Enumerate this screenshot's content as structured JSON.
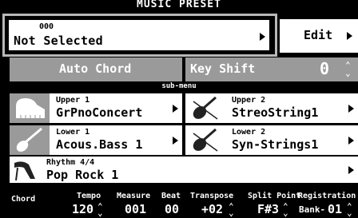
{
  "title": "MUSIC PRESET",
  "preset": {
    "number": "000",
    "name": "Not Selected"
  },
  "edit_label": "Edit",
  "auto_chord_label": "Auto Chord",
  "key_shift": {
    "label": "Key Shift",
    "value": "0"
  },
  "submenu_label": "sub-menu",
  "parts": {
    "upper1": {
      "label": "Upper 1",
      "tone": "GrPnoConcert",
      "icon": "piano-icon"
    },
    "upper2": {
      "label": "Upper 2",
      "tone": "StreoString1",
      "icon": "violin-icon"
    },
    "lower1": {
      "label": "Lower 1",
      "tone": "Acous.Bass 1",
      "icon": "guitar-icon"
    },
    "lower2": {
      "label": "Lower 2",
      "tone": "Syn-Strings1",
      "icon": "violin-icon"
    }
  },
  "rhythm": {
    "label": "Rhythm  4/4",
    "name": "Pop Rock 1",
    "icon": "drum-icon"
  },
  "status": {
    "chord": {
      "label": "Chord",
      "value": ""
    },
    "tempo": {
      "label": "Tempo",
      "value": "120"
    },
    "measure": {
      "label": "Measure",
      "value": "001"
    },
    "beat": {
      "label": "Beat",
      "value": "00"
    },
    "transpose": {
      "label": "Transpose",
      "value": "+02"
    },
    "split_point": {
      "label": "Split Point",
      "value": "F#3"
    },
    "registration": {
      "label": "Registration",
      "bank_label": "Bank-",
      "value": "01"
    }
  },
  "colors": {
    "background": "#000000",
    "gray_bar": "#9a9a9a",
    "panel": "#ffffff",
    "selection_border": "#b8b8b8"
  }
}
